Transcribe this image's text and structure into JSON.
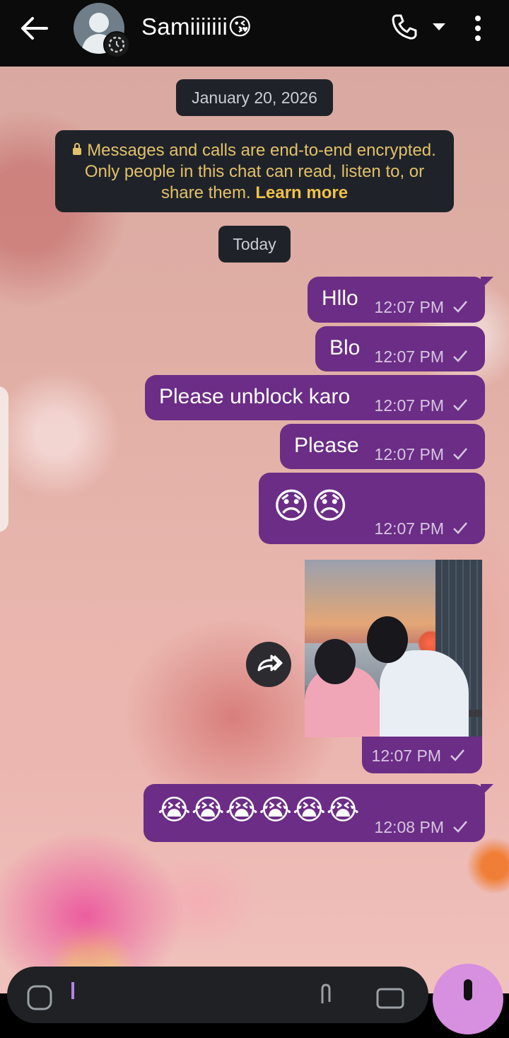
{
  "header": {
    "contact_name": "Samiiiiiii😘",
    "icons": [
      "back-arrow-icon",
      "avatar-icon",
      "status-ring-icon",
      "phone-icon",
      "dropdown-icon",
      "more-vert-icon"
    ]
  },
  "chat": {
    "date_label": "January 20, 2026",
    "encryption_text": "Messages and calls are end-to-end encrypted. Only people in this chat can read, listen to, or share them.",
    "learn_more": "Learn more",
    "today_label": "Today",
    "messages": [
      {
        "text": "Hllo",
        "time": "12:07 PM"
      },
      {
        "text": "Blo",
        "time": "12:07 PM"
      },
      {
        "text": "Please unblock karo",
        "time": "12:07 PM"
      },
      {
        "text": "Please",
        "time": "12:07 PM"
      },
      {
        "text": "😞😞",
        "time": "12:07 PM"
      },
      {
        "text": "",
        "time": "12:07 PM",
        "type": "image"
      },
      {
        "text": "😭😭😭😭😭😭",
        "time": "12:08 PM"
      }
    ]
  },
  "colors": {
    "bubble": "#6b2d86",
    "header": "#0b0b0b",
    "pill": "#1f2329",
    "learn_more": "#f1c24a",
    "mic_button": "#d78fe0"
  }
}
